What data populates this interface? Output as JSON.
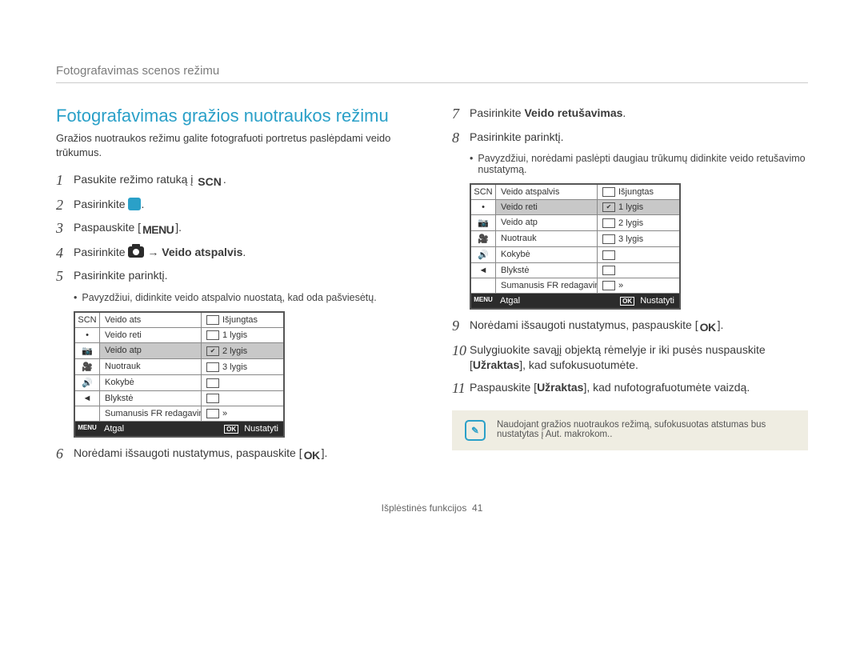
{
  "breadcrumb": "Fotografavimas scenos režimu",
  "section_title": "Fotografavimas gražios nuotraukos režimu",
  "intro": "Gražios nuotraukos režimu galite fotografuoti portretus paslėpdami veido trūkumus.",
  "left_steps": {
    "s1": {
      "num": "1",
      "pre": "Pasukite režimo ratuką į ",
      "post": "."
    },
    "s2": {
      "num": "2",
      "pre": "Pasirinkite ",
      "post": "."
    },
    "s3": {
      "num": "3",
      "pre": "Paspauskite [",
      "post": "]."
    },
    "s4": {
      "num": "4",
      "pre": "Pasirinkite ",
      "mid": " → ",
      "bold": "Veido atspalvis",
      "post": "."
    },
    "s5": {
      "num": "5",
      "text": "Pasirinkite parinktį."
    },
    "s5_sub": "Pavyzdžiui, didinkite veido atspalvio nuostatą, kad oda pašviesėtų.",
    "s6": {
      "num": "6",
      "pre": "Norėdami išsaugoti nustatymus, paspauskite [",
      "post": "]."
    }
  },
  "right_steps": {
    "s7": {
      "num": "7",
      "pre": "Pasirinkite ",
      "bold": "Veido retušavimas",
      "post": "."
    },
    "s8": {
      "num": "8",
      "text": "Pasirinkite parinktį."
    },
    "s8_sub": "Pavyzdžiui, norėdami paslėpti daugiau trūkumų didinkite veido retušavimo nustatymą.",
    "s9": {
      "num": "9",
      "pre": "Norėdami išsaugoti nustatymus, paspauskite [",
      "post": "]."
    },
    "s10": {
      "num": "10",
      "pre": "Sulygiuokite savąjį objektą rėmelyje ir iki pusės nuspauskite [",
      "bold": "Užraktas",
      "post": "], kad sufokusuotumėte."
    },
    "s11": {
      "num": "11",
      "pre": "Paspauskite [",
      "bold": "Užraktas",
      "post": "], kad nufotografuotumėte vaizdą."
    }
  },
  "cam_menu_left": {
    "rows": [
      "Veido ats",
      "Veido reti",
      "Veido atp",
      "Nuotrauk",
      "Kokybė",
      "Blykstė",
      "Sumanusis FR redagavimas"
    ],
    "side_icons": [
      "SCN",
      "•",
      "📷",
      "🎥",
      "🔊",
      "◄"
    ],
    "settings": [
      "Išjungtas",
      "1 lygis",
      "2 lygis",
      "3 lygis"
    ],
    "highlight_index": 2,
    "footer": {
      "back": "Atgal",
      "back_key": "MENU",
      "set": "Nustatyti",
      "set_key": "OK"
    }
  },
  "cam_menu_right": {
    "rows": [
      "Veido atspalvis",
      "Veido reti",
      "Veido atp",
      "Nuotrauk",
      "Kokybė",
      "Blykstė",
      "Sumanusis FR redagavimas"
    ],
    "side_icons": [
      "SCN",
      "•",
      "📷",
      "🎥",
      "🔊",
      "◄"
    ],
    "settings": [
      "Išjungtas",
      "1 lygis",
      "2 lygis",
      "3 lygis"
    ],
    "highlight_index": 1,
    "footer": {
      "back": "Atgal",
      "back_key": "MENU",
      "set": "Nustatyti",
      "set_key": "OK"
    }
  },
  "note": "Naudojant gražios nuotraukos režimą, sufokusuotas atstumas bus nustatytas į Aut. makrokom..",
  "footer_section": "Išplėstinės funkcijos",
  "footer_page": "41",
  "glyphs": {
    "scn": "SCN",
    "menu": "MENU",
    "ok": "OK",
    "arrow": "→"
  }
}
